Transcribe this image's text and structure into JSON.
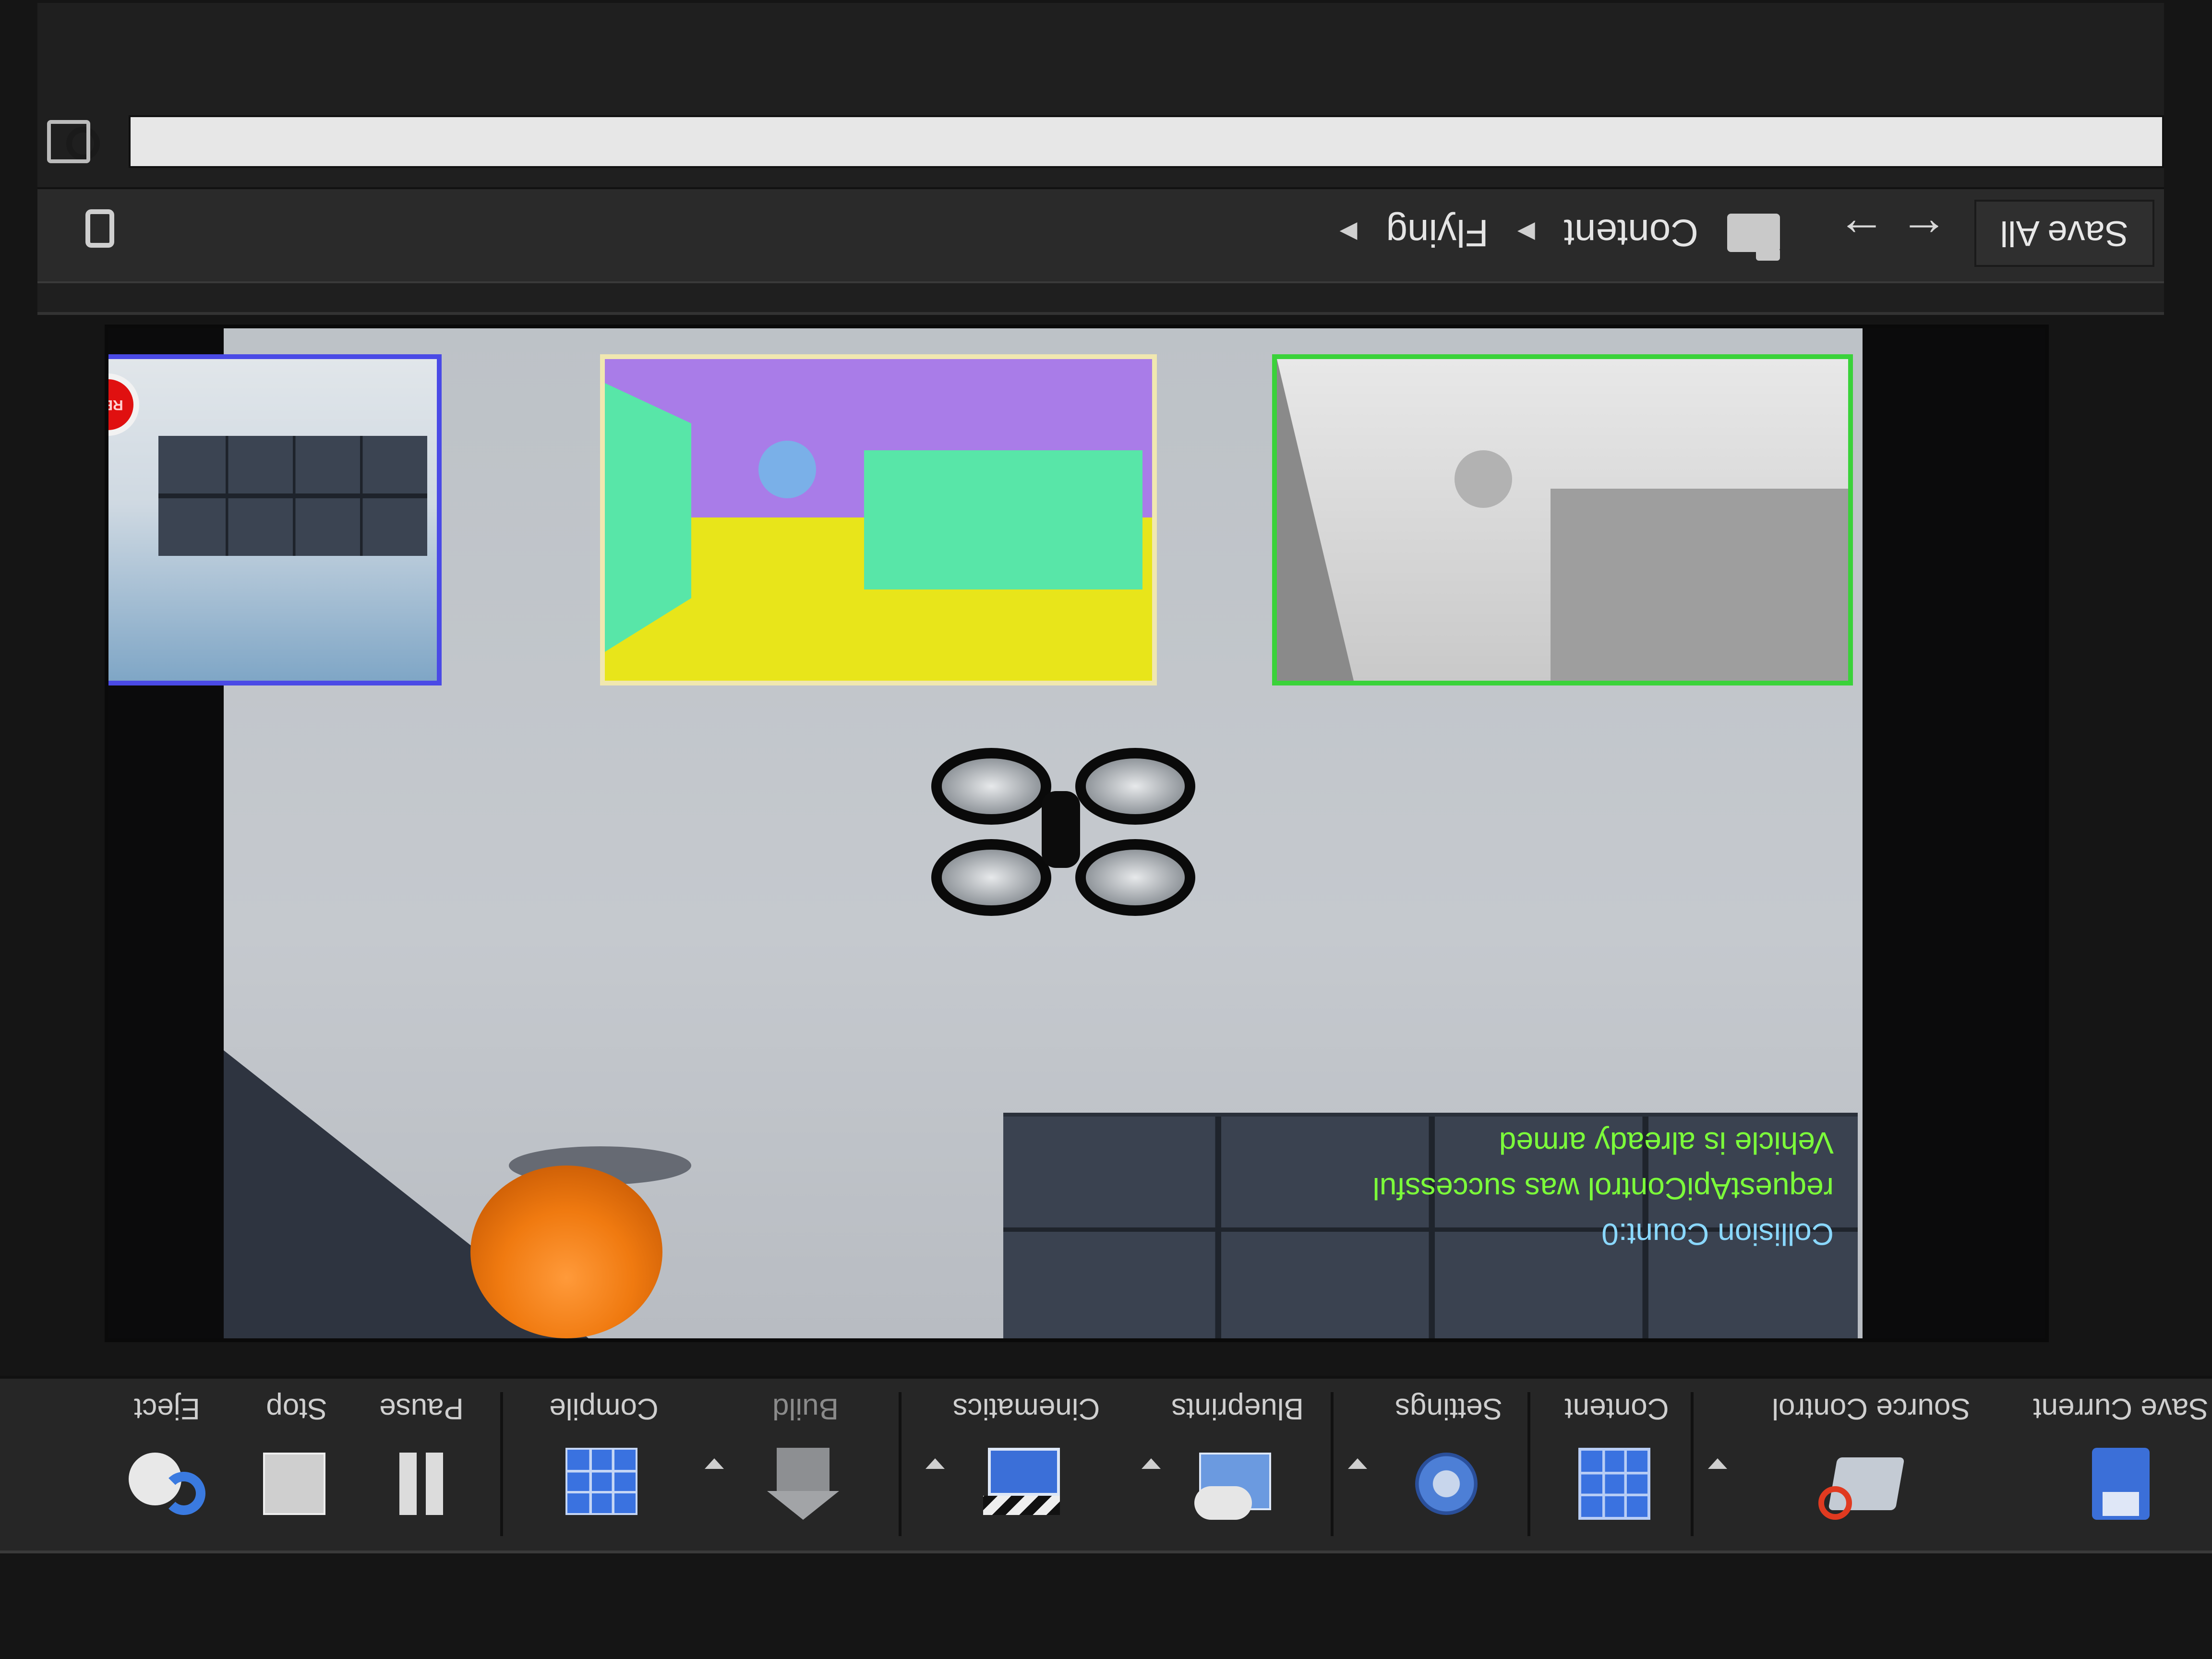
{
  "toolbar": {
    "save_current": "Save Current",
    "source_control": "Source Control",
    "content": "Content",
    "settings": "Settings",
    "blueprints": "Blueprints",
    "cinematics": "Cinematics",
    "build": "Build",
    "compile": "Compile",
    "pause": "Pause",
    "stop": "Stop",
    "eject": "Eject"
  },
  "hud": {
    "collision": "Collision Count:0",
    "request_api": "requestApiControl was successful",
    "vehicle_armed": "Vehicle is already armed",
    "colors": {
      "collision": "#8ad8ff",
      "status": "#7cff3a"
    }
  },
  "viewport": {
    "subwindows": [
      "depth",
      "segmentation",
      "scene"
    ],
    "record_button_label": "REC"
  },
  "content_browser": {
    "save_all": "Save All",
    "breadcrumbs": [
      "Content",
      "Flying"
    ],
    "search_placeholder": ""
  }
}
